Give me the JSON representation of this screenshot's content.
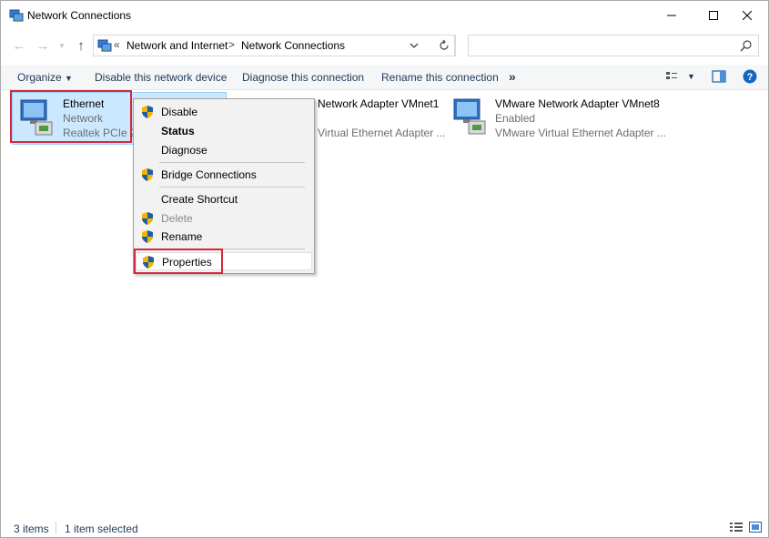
{
  "window": {
    "title": "Network Connections"
  },
  "address": {
    "prefix": "«",
    "crumbs": [
      "Network and Internet",
      "Network Connections"
    ],
    "separator": ">"
  },
  "search": {
    "placeholder": "",
    "value": ""
  },
  "commands": {
    "organize": "Organize",
    "disable_device": "Disable this network device",
    "diagnose": "Diagnose this connection",
    "rename": "Rename this connection",
    "more": "»"
  },
  "items": [
    {
      "name": "Ethernet",
      "status": "Network",
      "device": "Realtek PCIe 2."
    },
    {
      "name": "VMware Network Adapter VMnet1",
      "visible_name": "Network Adapter VMnet1",
      "status": "",
      "device": "Virtual Ethernet Adapter ..."
    },
    {
      "name": "VMware Network Adapter VMnet8",
      "status": "Enabled",
      "device": "VMware Virtual Ethernet Adapter ..."
    }
  ],
  "context_menu": {
    "items": [
      {
        "label": "Disable",
        "shield": true,
        "style": "normal"
      },
      {
        "label": "Status",
        "shield": false,
        "style": "bold"
      },
      {
        "label": "Diagnose",
        "shield": false,
        "style": "normal"
      },
      {
        "label": "Bridge Connections",
        "shield": true,
        "style": "normal"
      },
      {
        "label": "Create Shortcut",
        "shield": false,
        "style": "normal"
      },
      {
        "label": "Delete",
        "shield": true,
        "style": "disabled"
      },
      {
        "label": "Rename",
        "shield": true,
        "style": "normal"
      },
      {
        "label": "Properties",
        "shield": true,
        "style": "highlighted"
      }
    ]
  },
  "status_bar": {
    "count": "3 items",
    "selected": "1 item selected"
  },
  "colors": {
    "accent_red": "#d6283a",
    "selection": "#cce8ff",
    "link": "#1e395b"
  }
}
